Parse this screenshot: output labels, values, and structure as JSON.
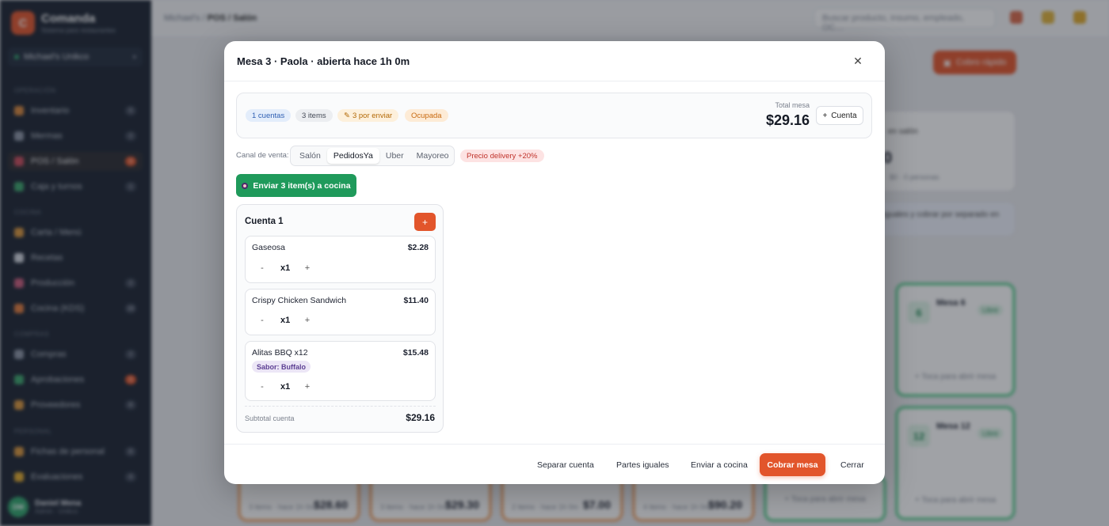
{
  "app": {
    "brand_initial": "C",
    "brand_name": "Comanda",
    "brand_sub": "Sistema para restaurantes",
    "workspace": "Michael's Unikco",
    "sections": [
      "OPERACIÓN",
      "COCINA",
      "COMPRAS",
      "PERSONAL"
    ],
    "nav": [
      {
        "label": "Inventario",
        "badge": "5"
      },
      {
        "label": "Mermas",
        "badge": "2"
      },
      {
        "label": "POS / Salón",
        "badge": "3"
      },
      {
        "label": "Caja y turnos",
        "badge": "1"
      },
      {
        "label": "Carta / Menú",
        "badge": ""
      },
      {
        "label": "Recetas",
        "badge": ""
      },
      {
        "label": "Producción",
        "badge": "2"
      },
      {
        "label": "Cocina (KDS)",
        "badge": "10"
      },
      {
        "label": "Compras",
        "badge": "2"
      },
      {
        "label": "Aprobaciones",
        "badge": "3"
      },
      {
        "label": "Proveedores",
        "badge": "8"
      },
      {
        "label": "Fichas de personal",
        "badge": "8"
      },
      {
        "label": "Evaluaciones",
        "badge": "4"
      }
    ],
    "user": {
      "initials": "DM",
      "name": "Daniel Mena",
      "role": "Admin · Unikco"
    },
    "breadcrumb": {
      "parent": "Michael's",
      "current": "POS / Salón"
    },
    "search_placeholder": "Buscar producto, insumo, empleado, OC…",
    "notif_count": "3",
    "quick_charge": "Cobro rápido",
    "bg_stat_label": "en salón",
    "bg_stat_value": "0",
    "bg_stat_sub": "$0 · 0 personas",
    "bg_hint": "iguales y cobrar por separado en",
    "bg_tables": [
      {
        "num": "6",
        "name": "Mesa 6",
        "status": "Libre",
        "hint": "+ Toca para abrir mesa"
      },
      {
        "num": "12",
        "name": "Mesa 12",
        "status": "Libre",
        "hint": "+ Toca para abrir mesa"
      }
    ],
    "bg_amounts": [
      {
        "meta": "3 items · hace 1h 0m",
        "amount": "$28.60"
      },
      {
        "meta": "3 items · hace 1h 0m",
        "amount": "$29.30"
      },
      {
        "meta": "2 items · hace 1h 0m",
        "amount": "$7.00"
      },
      {
        "meta": "4 items · hace 1h 0m",
        "amount": "$90.20"
      }
    ],
    "bg_free_hints": [
      "+ Toca para abrir mesa",
      "+ Toca para abrir mesa"
    ]
  },
  "modal": {
    "title": "Mesa 3 · Paola · abierta hace 1h 0m",
    "summary": {
      "accounts": "1 cuentas",
      "items": "3 items",
      "pending": "3 por enviar",
      "status": "Ocupada",
      "total_label": "Total mesa",
      "total_value": "$29.16",
      "add_account": "Cuenta"
    },
    "channel_label": "Canal de venta:",
    "channels": [
      "Salón",
      "PedidosYa",
      "Uber",
      "Mayoreo"
    ],
    "delivery_badge": "Precio delivery +20%",
    "send_button": "Enviar 3 item(s) a cocina",
    "account": {
      "title": "Cuenta 1",
      "add": "+",
      "items": [
        {
          "name": "Gaseosa",
          "price": "$2.28",
          "qty": "x1",
          "modifier": ""
        },
        {
          "name": "Crispy Chicken Sandwich",
          "price": "$11.40",
          "qty": "x1",
          "modifier": ""
        },
        {
          "name": "Alitas BBQ x12",
          "price": "$15.48",
          "qty": "x1",
          "modifier": "Sabor: Buffalo"
        }
      ],
      "subtotal_label": "Subtotal cuenta",
      "subtotal_value": "$29.16"
    },
    "footer": {
      "split": "Separar cuenta",
      "equal": "Partes iguales",
      "kitchen": "Enviar a cocina",
      "charge": "Cobrar mesa",
      "close": "Cerrar"
    }
  },
  "colors": {
    "accent": "#e2552b",
    "success": "#1f9a5b",
    "sidebar": "#1a2230"
  }
}
